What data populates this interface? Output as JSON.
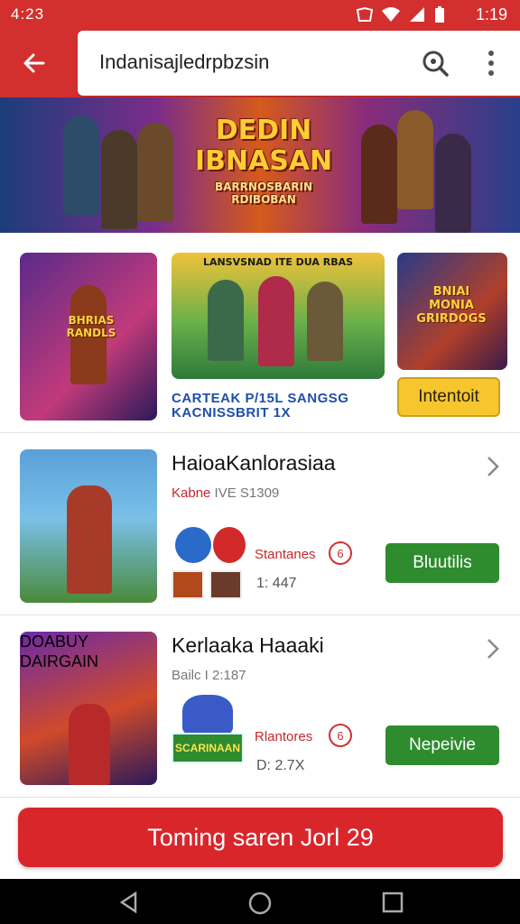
{
  "status_bar": {
    "left_text": "4:23",
    "time": "1:19"
  },
  "search": {
    "query": "Indanisajledrpbzsin"
  },
  "banner": {
    "title": "DEDIN IBNASAN",
    "subtitle": "BARRNOSBARIN RDIBOBAN"
  },
  "row1": {
    "tile1_label": "BHRIAS RANDLS",
    "tile2_label": "LANSVSNAD ITE DUA RBAS",
    "tile3_label": "BNIAI MONIA GRIRDOGS",
    "caption": "CARTEAK P/15L SANGSG KACNISSBRIT 1X",
    "button": "Intentoit"
  },
  "items": [
    {
      "title": "HaioaKanlorasiaa",
      "sub_red": "Kabne",
      "sub_rest": " IVE S1309",
      "stat1": "Stantanes",
      "badge": "6",
      "stat2": "1: 447",
      "button": "Bluutilis",
      "thumb_label": ""
    },
    {
      "title": "Kerlaaka Haaaki",
      "sub_red": "",
      "sub_rest": "Bailc I 2:187",
      "stat1": "Rlantores",
      "badge": "6",
      "stat2": "D: 2.7X",
      "button": "Nepeivie",
      "thumb_label": "DOABUY DAIRGAIN",
      "tag": "SCARINAAN"
    }
  ],
  "cta": {
    "label": "Toming saren Jorl 29"
  },
  "colors": {
    "primary": "#d32f2f",
    "accent_yellow": "#f7c62e",
    "green": "#2e8b2e"
  }
}
